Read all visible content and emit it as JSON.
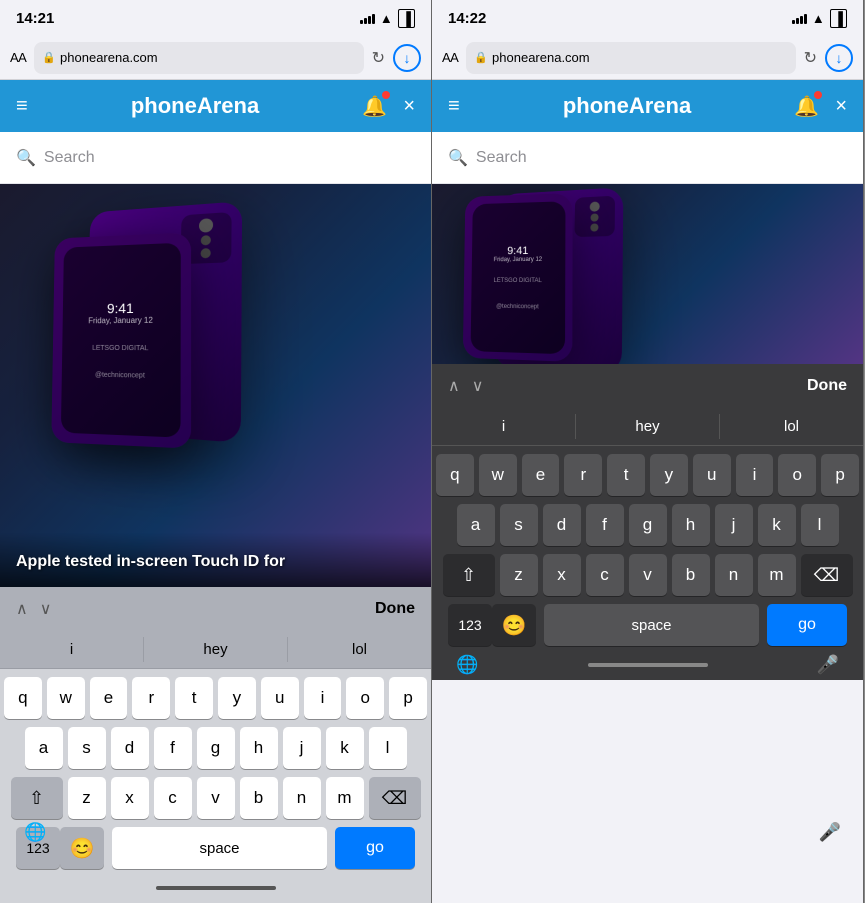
{
  "left_panel": {
    "status_bar": {
      "time": "14:21",
      "signal": "●●●●",
      "wifi": "WiFi",
      "battery": "Battery"
    },
    "browser_bar": {
      "aa_label": "AA",
      "url": "phonearena.com",
      "refresh_icon": "↻",
      "download_icon": "⬇"
    },
    "nav_bar": {
      "hamburger_icon": "≡",
      "title": "phoneArena",
      "bell_icon": "🔔",
      "close_icon": "×"
    },
    "search_bar": {
      "placeholder": "Search"
    },
    "article": {
      "title": "Apple tested in-screen Touch ID for"
    },
    "keyboard_toolbar": {
      "prev_arrow": "∧",
      "next_arrow": "∨",
      "done_label": "Done"
    },
    "autocomplete": {
      "words": [
        "i",
        "hey",
        "lol"
      ]
    },
    "keyboard": {
      "row1": [
        "q",
        "w",
        "e",
        "r",
        "t",
        "y",
        "u",
        "i",
        "o",
        "p"
      ],
      "row2": [
        "a",
        "s",
        "d",
        "f",
        "g",
        "h",
        "j",
        "k",
        "l"
      ],
      "row3": [
        "z",
        "x",
        "c",
        "v",
        "b",
        "n",
        "m"
      ],
      "shift_icon": "⇧",
      "delete_icon": "⌫",
      "bottom": {
        "num_label": "123",
        "emoji_label": "😊",
        "space_label": "space",
        "go_label": "go"
      }
    }
  },
  "right_panel": {
    "status_bar": {
      "time": "14:22",
      "signal": "●●●●",
      "wifi": "WiFi",
      "battery": "Battery"
    },
    "browser_bar": {
      "aa_label": "AA",
      "url": "phonearena.com",
      "refresh_icon": "↻",
      "download_icon": "⬇"
    },
    "nav_bar": {
      "hamburger_icon": "≡",
      "title": "phoneArena",
      "bell_icon": "🔔",
      "close_icon": "×"
    },
    "search_bar": {
      "placeholder": "Search"
    },
    "keyboard_toolbar": {
      "prev_arrow": "∧",
      "next_arrow": "∨",
      "done_label": "Done"
    },
    "autocomplete": {
      "words": [
        "i",
        "hey",
        "lol"
      ]
    },
    "keyboard": {
      "row1": [
        "q",
        "w",
        "e",
        "r",
        "t",
        "y",
        "u",
        "i",
        "o",
        "p"
      ],
      "row2": [
        "a",
        "s",
        "d",
        "f",
        "g",
        "h",
        "j",
        "k",
        "l"
      ],
      "row3": [
        "z",
        "x",
        "c",
        "v",
        "b",
        "n",
        "m"
      ],
      "shift_icon": "⇧",
      "delete_icon": "⌫",
      "bottom": {
        "num_label": "123",
        "emoji_label": "😊",
        "space_label": "space",
        "go_label": "go"
      }
    }
  },
  "colors": {
    "brand_blue": "#2196d6",
    "key_blue": "#007aff",
    "nav_bg": "#2196d6"
  }
}
